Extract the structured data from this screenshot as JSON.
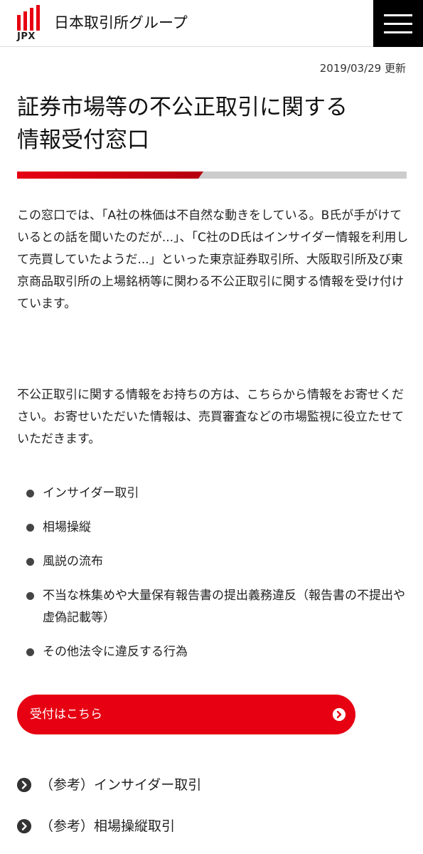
{
  "header": {
    "logo_text": "JPX",
    "brand": "日本取引所グループ",
    "logo_color": "#e60012"
  },
  "meta": {
    "updated": "2019/03/29 更新"
  },
  "page": {
    "title_line1": "証券市場等の不公正取引に関する",
    "title_line2": "情報受付窓口",
    "accent_color": "#e60012",
    "paragraph1": "この窓口では、「A社の株価は不自然な動きをしている。B氏が手がけているとの話を聞いたのだが...」、「C社のD氏はインサイダー情報を利用して売買していたようだ...」といった東京証券取引所、大阪取引所及び東京商品取引所の上場銘柄等に関わる不公正取引に関する情報を受け付けています。",
    "paragraph2": "不公正取引に関する情報をお持ちの方は、こちらから情報をお寄せください。お寄せいただいた情報は、売買審査などの市場監視に役立たせていただきます。",
    "bullets": [
      "インサイダー取引",
      "相場操縦",
      "風説の流布",
      "不当な株集めや大量保有報告書の提出義務違反（報告書の不提出や虚偽記載等）",
      "その他法令に違反する行為"
    ],
    "cta_label": "受付はこちら",
    "references": [
      "（参考）インサイダー取引",
      "（参考）相場操縦取引"
    ]
  }
}
